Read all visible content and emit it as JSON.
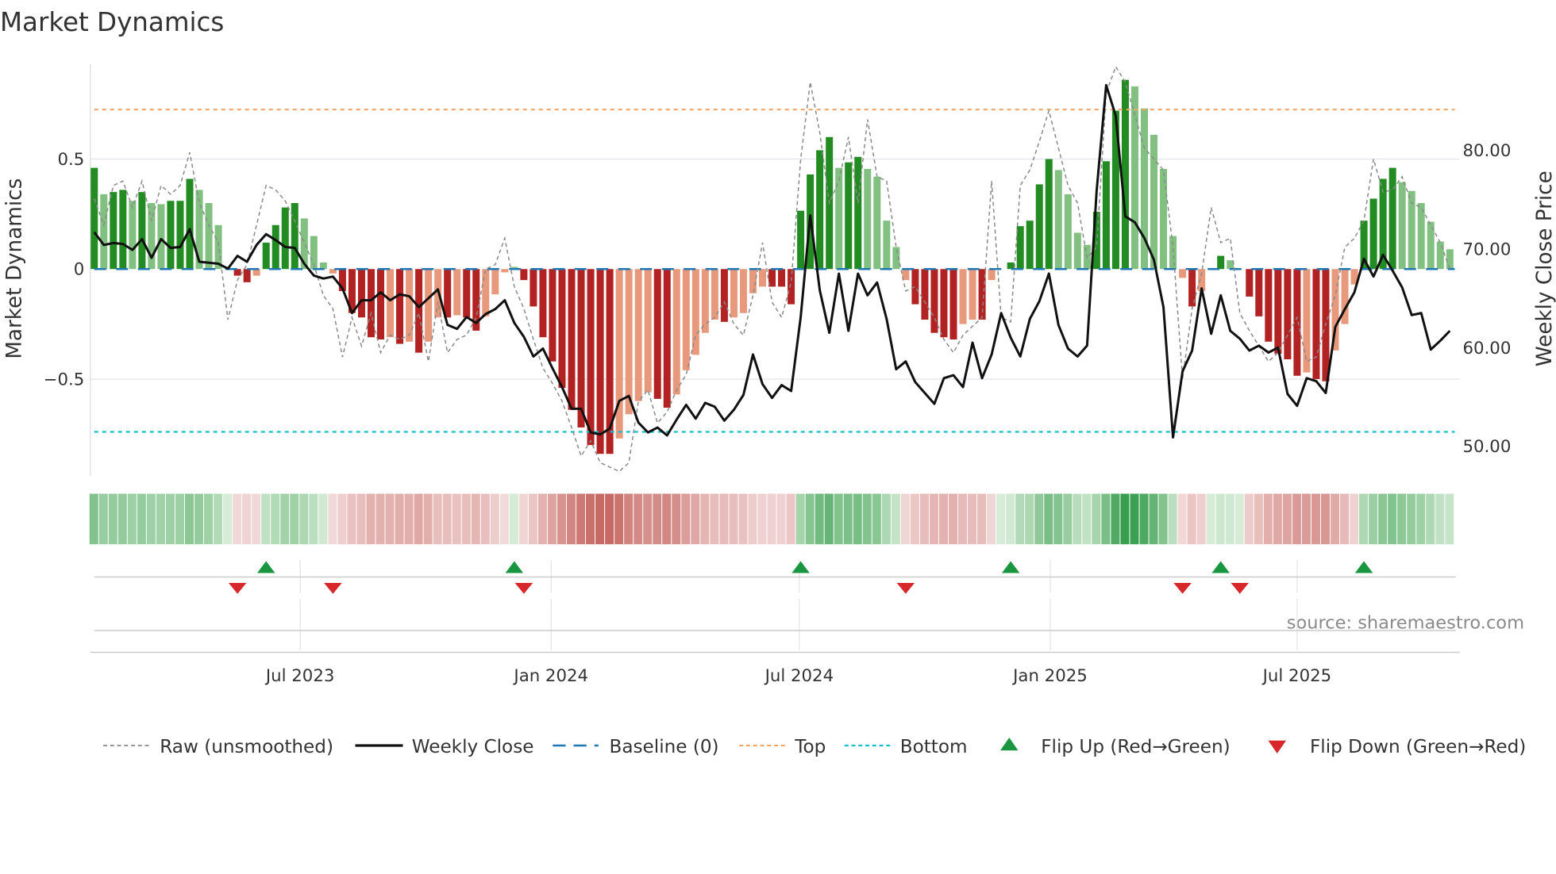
{
  "chart_data": {
    "type": "bar",
    "title": "Market Dynamics",
    "ylabel_left": "Market Dynamics",
    "ylabel_right": "Weekly Close Price",
    "frequency": "weekly",
    "start_date": "2023-01-31",
    "ylim_left": [
      -0.94,
      0.93
    ],
    "ylim_right": [
      46.9,
      88.6
    ],
    "left_ticks": [
      {
        "value": 0.5,
        "label": "0.5"
      },
      {
        "value": 0,
        "label": "0"
      },
      {
        "value": -0.5,
        "label": "−0.5"
      }
    ],
    "right_ticks": [
      {
        "value": 80,
        "label": "80.00"
      },
      {
        "value": 70,
        "label": "70.00"
      },
      {
        "value": 60,
        "label": "60.00"
      },
      {
        "value": 50,
        "label": "50.00"
      }
    ],
    "x_ticks": [
      {
        "date": "2023-07-01",
        "label": "Jul 2023"
      },
      {
        "date": "2024-01-01",
        "label": "Jan 2024"
      },
      {
        "date": "2024-07-01",
        "label": "Jul 2024"
      },
      {
        "date": "2025-01-01",
        "label": "Jan 2025"
      },
      {
        "date": "2025-07-01",
        "label": "Jul 2025"
      }
    ],
    "top_level": 0.725,
    "bottom_level": -0.74,
    "baseline": 0,
    "momentum": [
      0.46,
      0.34,
      0.35,
      0.36,
      0.31,
      0.35,
      0.3,
      0.295,
      0.31,
      0.31,
      0.41,
      0.36,
      0.3,
      0.2,
      0,
      -0.03,
      -0.06,
      -0.03,
      0.12,
      0.2,
      0.28,
      0.3,
      0.23,
      0.15,
      0.03,
      -0.02,
      -0.1,
      -0.2,
      -0.22,
      -0.31,
      -0.32,
      -0.31,
      -0.34,
      -0.33,
      -0.38,
      -0.33,
      -0.22,
      -0.22,
      -0.21,
      -0.22,
      -0.28,
      -0.215,
      -0.115,
      -0.015,
      0.01,
      -0.05,
      -0.17,
      -0.31,
      -0.42,
      -0.54,
      -0.64,
      -0.72,
      -0.8,
      -0.84,
      -0.84,
      -0.77,
      -0.66,
      -0.6,
      -0.56,
      -0.59,
      -0.63,
      -0.57,
      -0.46,
      -0.39,
      -0.29,
      -0.23,
      -0.24,
      -0.22,
      -0.2,
      -0.11,
      -0.08,
      -0.08,
      -0.08,
      -0.16,
      0.265,
      0.43,
      0.54,
      0.6,
      0.46,
      0.485,
      0.51,
      0.455,
      0.42,
      0.22,
      0.1,
      -0.05,
      -0.16,
      -0.23,
      -0.29,
      -0.31,
      -0.32,
      -0.25,
      -0.23,
      -0.23,
      -0.05,
      0,
      0.03,
      0.195,
      0.22,
      0.385,
      0.5,
      0.45,
      0.34,
      0.165,
      0.11,
      0.26,
      0.49,
      0.72,
      0.86,
      0.83,
      0.73,
      0.61,
      0.455,
      0.15,
      -0.04,
      -0.17,
      -0.1,
      0,
      0.06,
      0.04,
      0,
      -0.125,
      -0.215,
      -0.33,
      -0.385,
      -0.41,
      -0.485,
      -0.47,
      -0.5,
      -0.51,
      -0.37,
      -0.25,
      -0.07,
      0.22,
      0.32,
      0.41,
      0.46,
      0.395,
      0.355,
      0.3,
      0.215,
      0.125,
      0.09
    ],
    "raw": [
      0.32,
      0.2,
      0.38,
      0.4,
      0.28,
      0.4,
      0.22,
      0.38,
      0.34,
      0.38,
      0.53,
      0.3,
      0.2,
      0.12,
      -0.23,
      -0.05,
      0.02,
      0.2,
      0.38,
      0.36,
      0.31,
      0.22,
      0.12,
      0.02,
      -0.12,
      -0.18,
      -0.4,
      -0.22,
      -0.35,
      -0.2,
      -0.38,
      -0.3,
      -0.32,
      -0.3,
      -0.2,
      -0.42,
      -0.15,
      -0.38,
      -0.32,
      -0.3,
      -0.22,
      0.0,
      0.02,
      0.14,
      -0.08,
      -0.18,
      -0.32,
      -0.45,
      -0.52,
      -0.6,
      -0.72,
      -0.85,
      -0.78,
      -0.88,
      -0.9,
      -0.92,
      -0.88,
      -0.6,
      -0.55,
      -0.7,
      -0.65,
      -0.55,
      -0.48,
      -0.3,
      -0.25,
      -0.22,
      -0.15,
      -0.25,
      -0.3,
      -0.12,
      0.12,
      -0.15,
      -0.22,
      -0.06,
      0.5,
      0.85,
      0.62,
      0.3,
      0.4,
      0.6,
      0.3,
      0.68,
      0.42,
      0.4,
      0.1,
      -0.1,
      -0.08,
      -0.15,
      -0.22,
      -0.32,
      -0.38,
      -0.3,
      -0.26,
      -0.22,
      0.4,
      -0.22,
      -0.24,
      0.38,
      0.45,
      0.58,
      0.72,
      0.55,
      0.38,
      0.3,
      0.05,
      0.1,
      0.8,
      0.92,
      0.85,
      0.7,
      0.55,
      0.5,
      0.45,
      0.1,
      -0.5,
      -0.18,
      -0.02,
      0.28,
      0.12,
      0.14,
      -0.2,
      -0.28,
      -0.35,
      -0.42,
      -0.38,
      -0.3,
      -0.22,
      -0.42,
      -0.4,
      -0.25,
      -0.12,
      0.1,
      0.14,
      0.22,
      0.5,
      0.35,
      0.36,
      0.42,
      0.3,
      0.28,
      0.2,
      0.12,
      0.0
    ],
    "close": [
      71.6,
      70.3,
      70.5,
      70.4,
      69.8,
      70.9,
      69.0,
      70.9,
      70.0,
      70.1,
      71.9,
      68.6,
      68.5,
      68.4,
      67.9,
      69.2,
      68.6,
      70.3,
      71.4,
      70.8,
      70.1,
      70.0,
      68.4,
      67.2,
      66.9,
      67.1,
      65.9,
      63.4,
      64.7,
      64.7,
      65.5,
      64.7,
      65.3,
      65.1,
      64.0,
      64.9,
      65.8,
      62.2,
      61.8,
      63.0,
      62.4,
      63.3,
      63.8,
      64.7,
      62.4,
      61.0,
      59.0,
      59.8,
      57.8,
      55.9,
      53.7,
      53.7,
      51.3,
      51.1,
      51.7,
      54.5,
      55.0,
      52.3,
      51.3,
      51.8,
      51.0,
      52.6,
      54.1,
      52.7,
      54.3,
      53.9,
      52.5,
      53.6,
      55.1,
      59.2,
      56.2,
      54.8,
      56.1,
      55.5,
      63.0,
      73.3,
      65.7,
      61.4,
      67.4,
      61.6,
      67.4,
      65.2,
      66.5,
      62.8,
      57.7,
      58.5,
      56.4,
      55.3,
      54.2,
      56.8,
      57.1,
      55.9,
      60.4,
      56.8,
      59.2,
      63.4,
      60.9,
      59.0,
      62.8,
      64.6,
      67.4,
      62.2,
      59.8,
      59.0,
      60.1,
      75.8,
      86.5,
      83.4,
      73.2,
      72.6,
      71.0,
      68.8,
      64.0,
      50.8,
      57.5,
      59.6,
      65.9,
      61.3,
      65.2,
      61.6,
      60.8,
      59.6,
      60.1,
      59.4,
      59.9,
      55.2,
      54.0,
      56.8,
      56.5,
      55.3,
      62.0,
      63.8,
      65.5,
      68.9,
      67.1,
      69.3,
      67.7,
      66.0,
      63.2,
      63.4,
      59.7,
      60.6,
      61.6
    ],
    "flip_up_weeks": [
      18,
      44,
      74,
      96,
      118,
      133
    ],
    "flip_down_weeks": [
      15,
      25,
      45,
      85,
      114,
      120
    ],
    "colors": {
      "pos_strong": "#228b22",
      "pos_weak": "#81c081",
      "neg_strong": "#b22222",
      "neg_weak": "#e8997c",
      "close": "#111111",
      "raw": "#8a8a8a",
      "baseline": "#1f77b4",
      "top": "#f4a261",
      "bottom": "#17becf",
      "flip_up": "#1a9641",
      "flip_down": "#d7272b"
    },
    "legend": {
      "placement": "bottom",
      "items": [
        {
          "key": "raw",
          "label": "Raw (unsmoothed)"
        },
        {
          "key": "close",
          "label": "Weekly Close"
        },
        {
          "key": "baseline",
          "label": "Baseline (0)"
        },
        {
          "key": "top",
          "label": "Top"
        },
        {
          "key": "bottom",
          "label": "Bottom"
        },
        {
          "key": "flip_up",
          "label": "Flip Up (Red→Green)"
        },
        {
          "key": "flip_down",
          "label": "Flip Down (Green→Red)"
        }
      ]
    },
    "source": "source: sharemaestro.com"
  }
}
